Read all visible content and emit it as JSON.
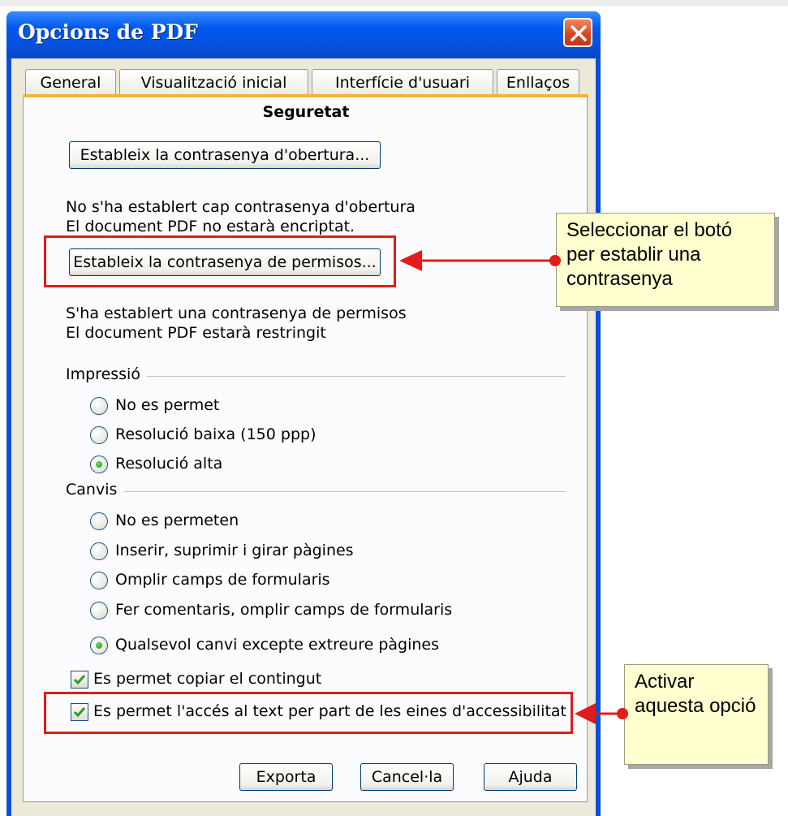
{
  "dialog": {
    "title": "Opcions de PDF",
    "tabs": [
      "General",
      "Visualització inicial",
      "Interfície d'usuari",
      "Enllaços"
    ],
    "active_tab": "Seguretat"
  },
  "security": {
    "open_password_button": "Estableix la contrasenya d'obertura...",
    "open_status_line1": "No s'ha establert cap contrasenya d'obertura",
    "open_status_line2": "El document PDF no estarà encriptat.",
    "perm_password_button": "Estableix la contrasenya de permisos...",
    "perm_status_line1": "S'ha establert una contrasenya de permisos",
    "perm_status_line2": "El document PDF estarà restringit"
  },
  "printing": {
    "label": "Impressió",
    "options": [
      "No es permet",
      "Resolució baixa (150 ppp)",
      "Resolució alta"
    ],
    "selected": "Resolució alta"
  },
  "changes": {
    "label": "Canvis",
    "options": [
      "No es permeten",
      "Inserir, suprimir i girar pàgines",
      "Omplir camps de formularis",
      "Fer comentaris, omplir camps de formularis",
      "Qualsevol canvi excepte extreure pàgines"
    ],
    "selected": "Qualsevol canvi excepte extreure pàgines"
  },
  "checkboxes": {
    "copy_content": "Es permet copiar el contingut",
    "copy_content_checked": true,
    "accessibility": "Es permet l'accés al text per part de les eines d'accessibilitat",
    "accessibility_checked": true
  },
  "footer": {
    "export": "Exporta",
    "cancel": "Cancel·la",
    "help": "Ajuda"
  },
  "callouts": {
    "set_password": "Seleccionar el botó per establir una contrasenya",
    "enable_option": "Activar aquesta opció"
  },
  "colors": {
    "highlight_red": "#e41b1b",
    "callout_bg": "#ffffcf",
    "titlebar_blue": "#0058ee"
  }
}
